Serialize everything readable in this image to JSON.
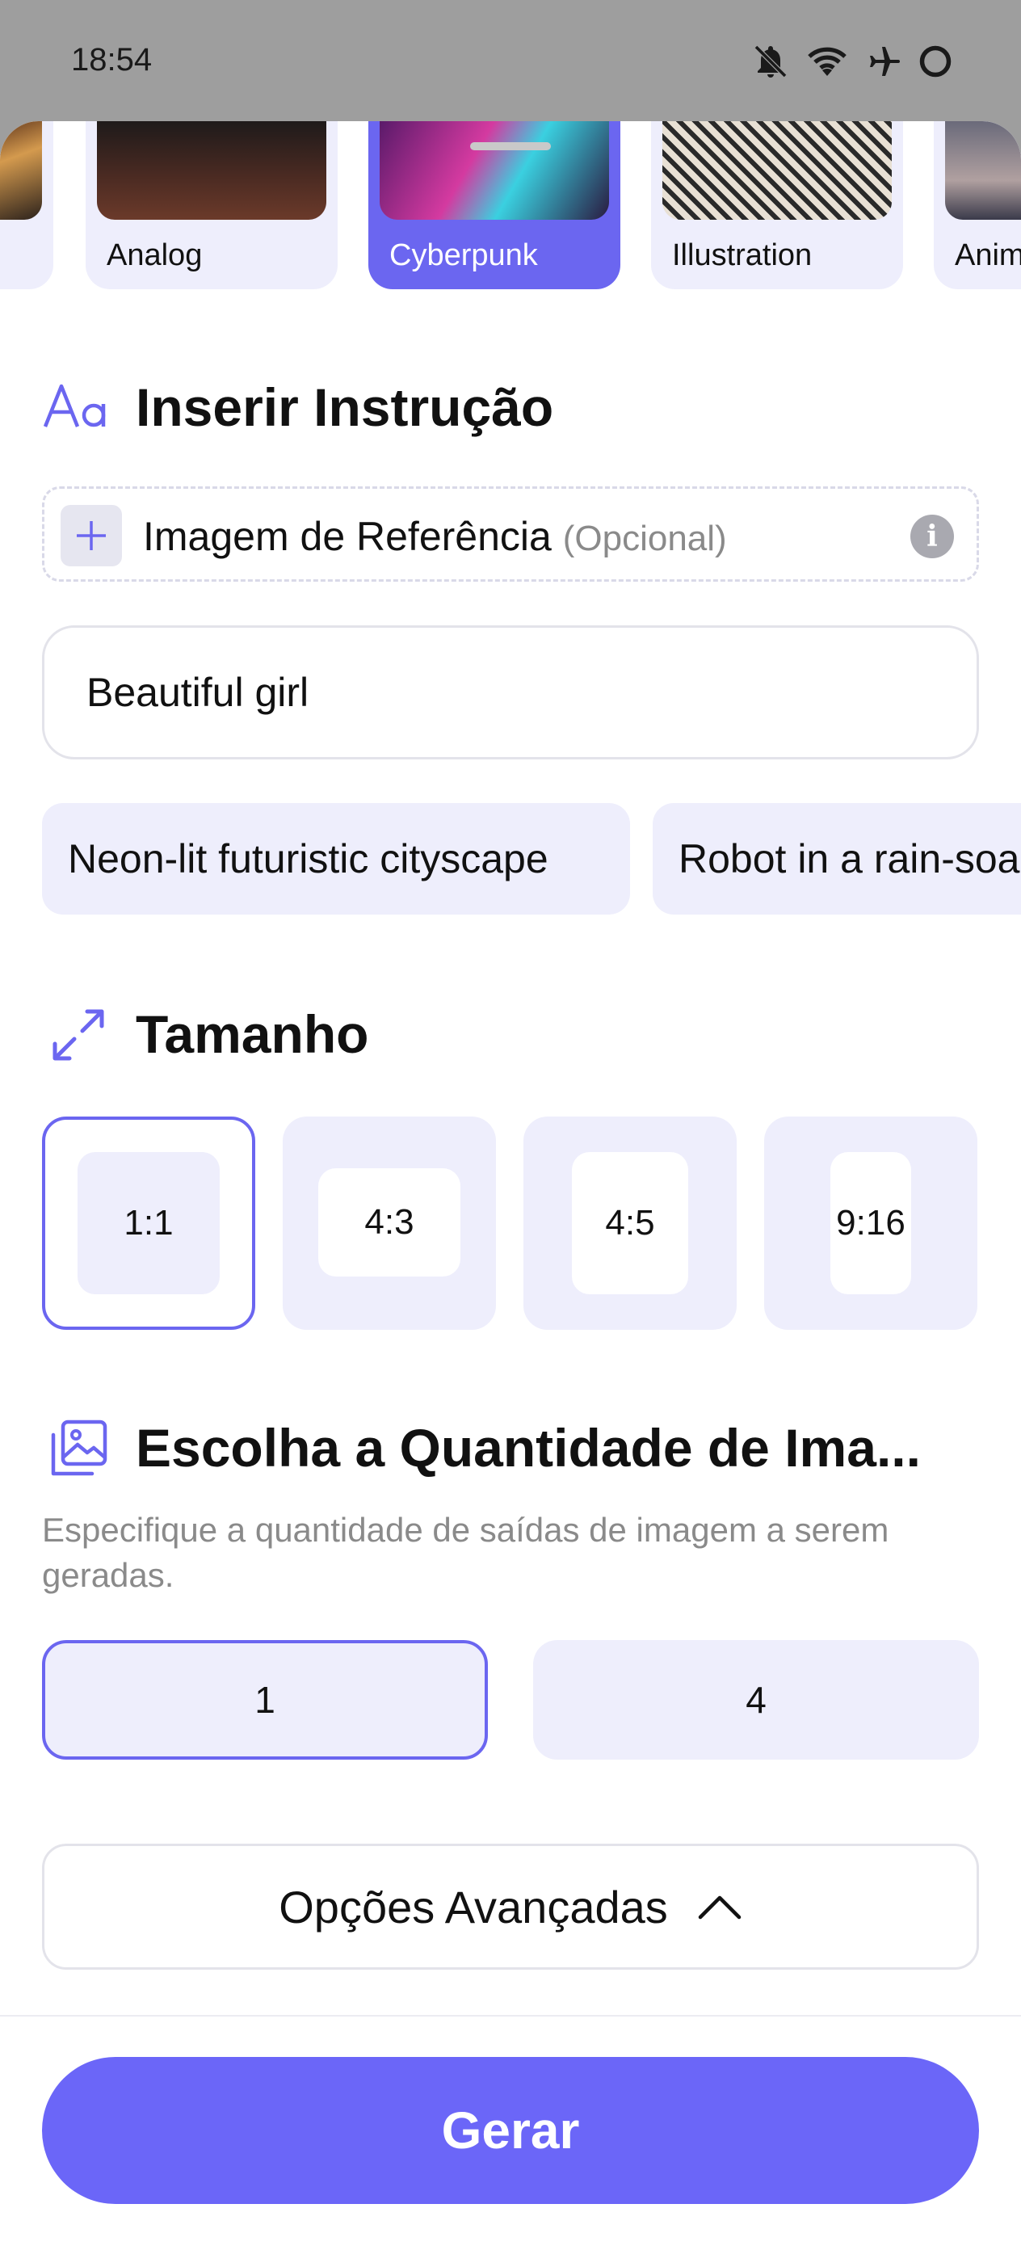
{
  "status_bar": {
    "time": "18:54",
    "icons": [
      "bell-off-icon",
      "wifi-icon",
      "airplane-icon",
      "loading-ring-icon"
    ]
  },
  "styles": {
    "items": [
      {
        "label": "",
        "selected": false
      },
      {
        "label": "Analog",
        "selected": false
      },
      {
        "label": "Cyberpunk",
        "selected": true
      },
      {
        "label": "Illustration",
        "selected": false
      },
      {
        "label": "Anim",
        "selected": false
      }
    ]
  },
  "prompt_section": {
    "title": "Inserir Instrução",
    "icon": "text-format-icon",
    "reference_label": "Imagem de Referência",
    "reference_optional": "(Opcional)",
    "prompt_value": "Beautiful girl",
    "suggestions": [
      "Neon-lit futuristic cityscape",
      "Robot in a rain-soa"
    ]
  },
  "size_section": {
    "title": "Tamanho",
    "icon": "expand-arrows-icon",
    "options": [
      {
        "label": "1:1",
        "selected": true
      },
      {
        "label": "4:3",
        "selected": false
      },
      {
        "label": "4:5",
        "selected": false
      },
      {
        "label": "9:16",
        "selected": false
      }
    ]
  },
  "quantity_section": {
    "title": "Escolha a Quantidade de Ima...",
    "icon": "image-stack-icon",
    "description": "Especifique a quantidade de saídas de imagem a serem geradas.",
    "options": [
      {
        "label": "1",
        "selected": true
      },
      {
        "label": "4",
        "selected": false
      }
    ]
  },
  "advanced_label": "Opções Avançadas",
  "generate_label": "Gerar",
  "colors": {
    "accent": "#6b66f0",
    "chip_bg": "#eeeefc",
    "button_primary": "#6b66f8"
  }
}
